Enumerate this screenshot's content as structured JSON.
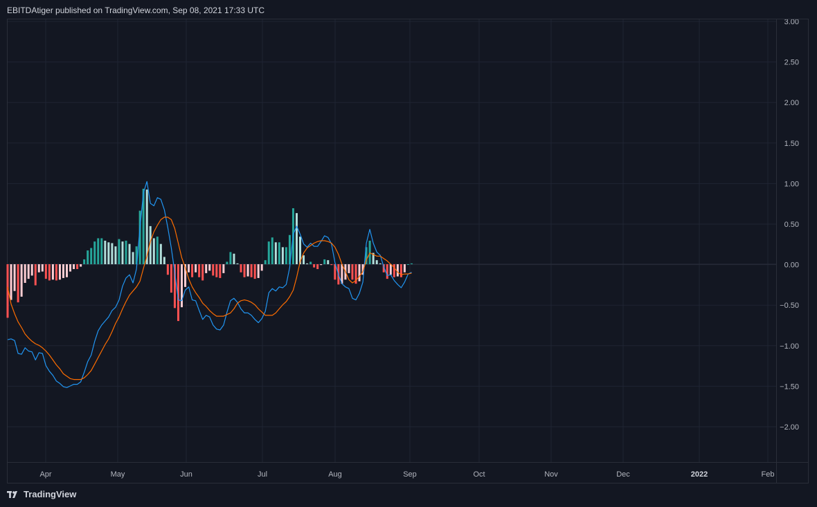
{
  "header": {
    "attribution": "EBITDAtiger published on TradingView.com, Sep 08, 2021 17:33 UTC"
  },
  "footer": {
    "brand": "TradingView",
    "logo_icon": "tradingview-logo-icon"
  },
  "colors": {
    "background": "#131722",
    "grid": "#1f2433",
    "border": "#2a2e39",
    "macd_line": "#2196f3",
    "signal_line": "#ff6d00",
    "hist_pos_strong": "#26a69a",
    "hist_pos_weak": "#b2dfdb",
    "hist_neg_strong": "#ff5252",
    "hist_neg_weak": "#ffcdd2"
  },
  "chart_data": {
    "type": "line",
    "xlabel": "",
    "ylabel": "",
    "ylim": [
      -2.45,
      3.0
    ],
    "y_ticks": [
      "3.00",
      "2.50",
      "2.00",
      "1.50",
      "1.00",
      "0.50",
      "0.00",
      "−0.50",
      "−1.00",
      "−1.50",
      "−2.00"
    ],
    "x_ticks": [
      "Apr",
      "May",
      "Jun",
      "Jul",
      "Aug",
      "Sep",
      "Oct",
      "Nov",
      "Dec",
      "2022",
      "Feb"
    ],
    "x_ticks_bold": [
      "2022"
    ],
    "grid": true,
    "series": [
      {
        "name": "",
        "kind": "line",
        "color": "#2196f3",
        "values": [
          -0.93,
          -0.92,
          -0.94,
          -1.1,
          -1.11,
          -1.03,
          -1.07,
          -1.08,
          -1.18,
          -1.09,
          -1.1,
          -1.25,
          -1.32,
          -1.37,
          -1.44,
          -1.47,
          -1.51,
          -1.52,
          -1.5,
          -1.48,
          -1.48,
          -1.45,
          -1.33,
          -1.2,
          -1.12,
          -0.95,
          -0.82,
          -0.75,
          -0.7,
          -0.65,
          -0.57,
          -0.53,
          -0.44,
          -0.27,
          -0.17,
          -0.13,
          -0.23,
          -0.06,
          0.45,
          0.88,
          1.02,
          0.75,
          0.72,
          0.82,
          0.8,
          0.67,
          0.45,
          0.2,
          -0.1,
          -0.44,
          -0.45,
          -0.32,
          -0.28,
          -0.44,
          -0.45,
          -0.57,
          -0.68,
          -0.63,
          -0.65,
          -0.75,
          -0.8,
          -0.81,
          -0.75,
          -0.59,
          -0.45,
          -0.42,
          -0.47,
          -0.55,
          -0.6,
          -0.6,
          -0.63,
          -0.68,
          -0.72,
          -0.67,
          -0.58,
          -0.35,
          -0.3,
          -0.33,
          -0.28,
          -0.29,
          -0.25,
          -0.04,
          0.37,
          0.47,
          0.37,
          0.25,
          0.21,
          0.26,
          0.22,
          0.22,
          0.28,
          0.35,
          0.33,
          0.25,
          0.02,
          -0.13,
          -0.24,
          -0.28,
          -0.3,
          -0.42,
          -0.44,
          -0.36,
          -0.22,
          0.26,
          0.43,
          0.26,
          0.15,
          0.11,
          -0.03,
          -0.14,
          -0.13,
          -0.2,
          -0.25,
          -0.29,
          -0.22,
          -0.12,
          -0.1
        ]
      },
      {
        "name": "",
        "kind": "line",
        "color": "#ff6d00",
        "values": [
          -0.28,
          -0.49,
          -0.61,
          -0.71,
          -0.78,
          -0.86,
          -0.91,
          -0.95,
          -0.98,
          -1.0,
          -1.03,
          -1.07,
          -1.12,
          -1.18,
          -1.24,
          -1.29,
          -1.35,
          -1.38,
          -1.41,
          -1.42,
          -1.42,
          -1.42,
          -1.4,
          -1.36,
          -1.31,
          -1.23,
          -1.15,
          -1.07,
          -0.99,
          -0.92,
          -0.83,
          -0.73,
          -0.65,
          -0.55,
          -0.46,
          -0.38,
          -0.33,
          -0.28,
          -0.21,
          -0.05,
          0.1,
          0.28,
          0.4,
          0.48,
          0.55,
          0.58,
          0.58,
          0.55,
          0.44,
          0.26,
          0.08,
          -0.04,
          -0.18,
          -0.28,
          -0.35,
          -0.41,
          -0.48,
          -0.52,
          -0.57,
          -0.61,
          -0.64,
          -0.64,
          -0.64,
          -0.62,
          -0.6,
          -0.55,
          -0.48,
          -0.45,
          -0.44,
          -0.45,
          -0.47,
          -0.5,
          -0.55,
          -0.59,
          -0.63,
          -0.63,
          -0.63,
          -0.6,
          -0.55,
          -0.5,
          -0.46,
          -0.4,
          -0.32,
          -0.16,
          0.03,
          0.14,
          0.2,
          0.23,
          0.26,
          0.28,
          0.29,
          0.29,
          0.28,
          0.26,
          0.21,
          0.12,
          0.0,
          -0.09,
          -0.19,
          -0.23,
          -0.2,
          -0.15,
          -0.09,
          0.05,
          0.14,
          0.12,
          0.1,
          0.1,
          0.07,
          0.04,
          0.0,
          -0.04,
          -0.1,
          -0.13,
          -0.12,
          -0.12,
          -0.11
        ]
      },
      {
        "name": "",
        "kind": "histogram",
        "values": [
          -0.66,
          -0.44,
          -0.33,
          -0.47,
          -0.4,
          -0.23,
          -0.18,
          -0.14,
          -0.26,
          -0.1,
          -0.09,
          -0.18,
          -0.2,
          -0.19,
          -0.2,
          -0.19,
          -0.17,
          -0.16,
          -0.09,
          -0.06,
          -0.06,
          -0.03,
          0.06,
          0.17,
          0.2,
          0.28,
          0.32,
          0.32,
          0.29,
          0.27,
          0.26,
          0.22,
          0.31,
          0.28,
          0.29,
          0.25,
          0.15,
          0.22,
          0.66,
          0.93,
          0.92,
          0.47,
          0.32,
          0.34,
          0.25,
          0.09,
          -0.13,
          -0.35,
          -0.54,
          -0.7,
          -0.53,
          -0.28,
          -0.1,
          -0.16,
          -0.1,
          -0.16,
          -0.2,
          -0.11,
          -0.08,
          -0.14,
          -0.16,
          -0.17,
          -0.11,
          0.03,
          0.15,
          0.13,
          0.01,
          -0.1,
          -0.16,
          -0.15,
          -0.16,
          -0.18,
          -0.17,
          -0.08,
          0.05,
          0.28,
          0.33,
          0.27,
          0.27,
          0.21,
          0.21,
          0.36,
          0.69,
          0.63,
          0.34,
          0.11,
          0.01,
          0.03,
          -0.04,
          -0.06,
          -0.01,
          0.06,
          0.05,
          -0.01,
          -0.19,
          -0.25,
          -0.24,
          -0.19,
          -0.11,
          -0.19,
          -0.24,
          -0.21,
          -0.13,
          0.21,
          0.29,
          0.14,
          0.05,
          0.01,
          -0.1,
          -0.18,
          -0.13,
          -0.16,
          -0.15,
          -0.16,
          -0.1,
          0.0,
          0.01
        ]
      }
    ]
  }
}
